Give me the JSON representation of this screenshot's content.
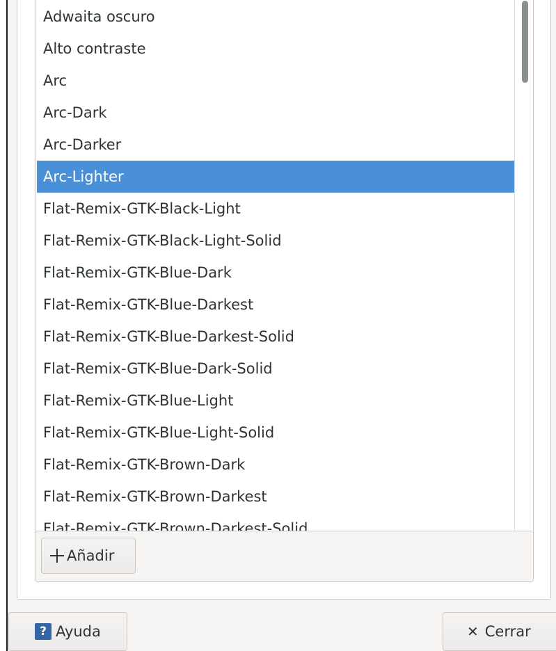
{
  "theme_list": {
    "items": [
      {
        "label": "Adwaita oscuro",
        "selected": false
      },
      {
        "label": "Alto contraste",
        "selected": false
      },
      {
        "label": "Arc",
        "selected": false
      },
      {
        "label": "Arc-Dark",
        "selected": false
      },
      {
        "label": "Arc-Darker",
        "selected": false
      },
      {
        "label": "Arc-Lighter",
        "selected": true
      },
      {
        "label": "Flat-Remix-GTK-Black-Light",
        "selected": false
      },
      {
        "label": "Flat-Remix-GTK-Black-Light-Solid",
        "selected": false
      },
      {
        "label": "Flat-Remix-GTK-Blue-Dark",
        "selected": false
      },
      {
        "label": "Flat-Remix-GTK-Blue-Darkest",
        "selected": false
      },
      {
        "label": "Flat-Remix-GTK-Blue-Darkest-Solid",
        "selected": false
      },
      {
        "label": "Flat-Remix-GTK-Blue-Dark-Solid",
        "selected": false
      },
      {
        "label": "Flat-Remix-GTK-Blue-Light",
        "selected": false
      },
      {
        "label": "Flat-Remix-GTK-Blue-Light-Solid",
        "selected": false
      },
      {
        "label": "Flat-Remix-GTK-Brown-Dark",
        "selected": false
      },
      {
        "label": "Flat-Remix-GTK-Brown-Darkest",
        "selected": false
      },
      {
        "label": "Flat-Remix-GTK-Brown-Darkest-Solid",
        "selected": false
      }
    ],
    "selection_color": "#4a90d9"
  },
  "toolbar": {
    "add_label": "Añadir",
    "add_icon": "plus-icon"
  },
  "footer": {
    "help_label": "Ayuda",
    "help_icon": "help-icon",
    "close_label": "Cerrar",
    "close_icon": "close-icon"
  }
}
